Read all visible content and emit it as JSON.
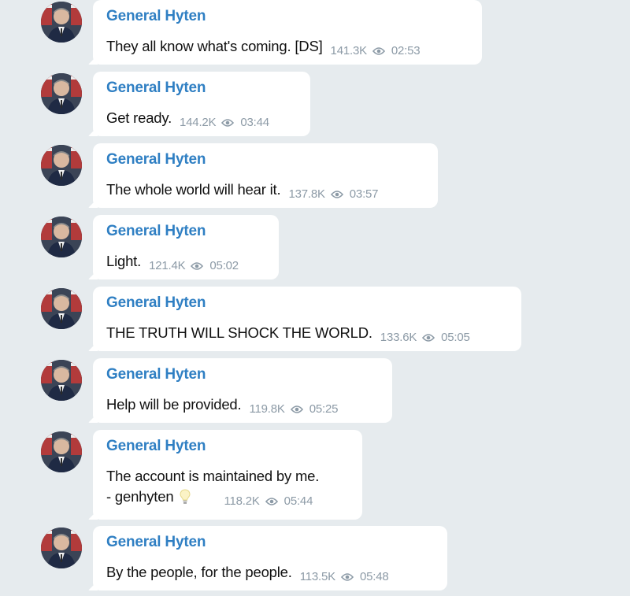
{
  "messages": [
    {
      "sender": "General Hyten",
      "text": "They all know what's coming. [DS]",
      "views": "141.3K",
      "time": "02:53"
    },
    {
      "sender": "General Hyten",
      "text": "Get ready.",
      "views": "144.2K",
      "time": "03:44"
    },
    {
      "sender": "General Hyten",
      "text": "The whole world will hear it.",
      "views": "137.8K",
      "time": "03:57"
    },
    {
      "sender": "General Hyten",
      "text": "Light.",
      "views": "121.4K",
      "time": "05:02"
    },
    {
      "sender": "General Hyten",
      "text": "THE TRUTH WILL SHOCK THE WORLD.",
      "views": "133.6K",
      "time": "05:05"
    },
    {
      "sender": "General Hyten",
      "text": "Help will be provided.",
      "views": "119.8K",
      "time": "05:25"
    },
    {
      "sender": "General Hyten",
      "text": "The account is maintained by me.",
      "text_line2": "- genhyten",
      "emoji": "light-bulb-icon",
      "views": "118.2K",
      "time": "05:44"
    },
    {
      "sender": "General Hyten",
      "text": "By the people, for the people.",
      "views": "113.5K",
      "time": "05:48"
    }
  ],
  "icons": {
    "views": "eye-icon"
  },
  "colors": {
    "background": "#e6ebee",
    "bubble": "#ffffff",
    "sender": "#2f7fc3",
    "meta": "#8c9aa6"
  }
}
